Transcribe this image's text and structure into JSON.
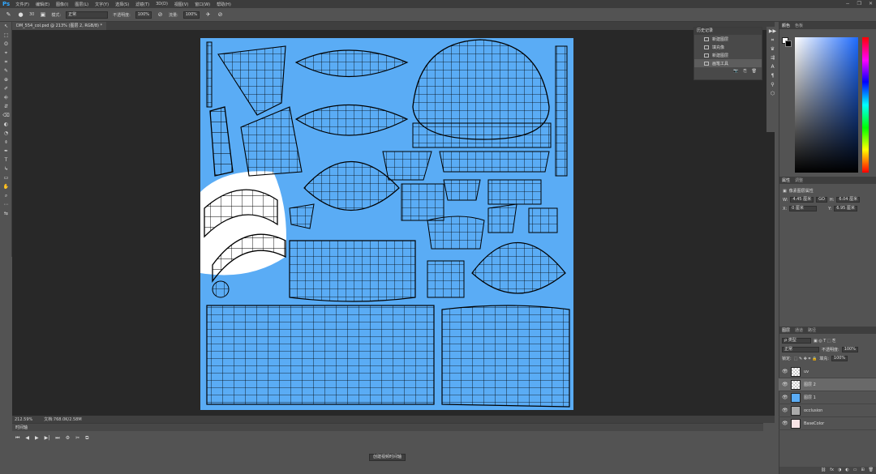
{
  "app": {
    "logo": "Ps"
  },
  "menu": [
    "文件(F)",
    "编辑(E)",
    "图像(I)",
    "图层(L)",
    "文字(Y)",
    "选择(S)",
    "滤镜(T)",
    "3D(D)",
    "视图(V)",
    "窗口(W)",
    "帮助(H)"
  ],
  "window_controls": [
    "−",
    "❐",
    "✕"
  ],
  "options": {
    "brush_size": "30",
    "mode_label": "模式:",
    "mode_value": "正常",
    "opacity_label": "不透明度:",
    "opacity_value": "100%",
    "flow_label": "流量:",
    "flow_value": "100%"
  },
  "tools": [
    "↖",
    "⬚",
    "ʘ",
    "⌖",
    "⌗",
    "✎",
    "⊕",
    "✐",
    "⎆",
    "⇵",
    "⌫",
    "◐",
    "◔",
    "⌽",
    "✒",
    "T",
    "↳",
    "▭",
    "✋",
    "⌕",
    "⋯",
    "⇆"
  ],
  "document_tab": "DM_554_col.psd @ 213% (图层 2, RGB/8) *",
  "status": {
    "zoom": "212.59%",
    "doc": "文档:768.0K/2.58M"
  },
  "timeline": {
    "title": "时间轴",
    "controls": [
      "⏮",
      "◀",
      "▶",
      "▶|",
      "⏭",
      "⚙",
      "✂",
      "⧉"
    ],
    "create_button": "创建视频时间轴"
  },
  "history": {
    "tabs": [
      "历史记录"
    ],
    "items": [
      {
        "label": "新建图层",
        "selected": false
      },
      {
        "label": "填充像",
        "selected": false
      },
      {
        "label": "新建图层",
        "selected": false
      },
      {
        "label": "画笔工具",
        "selected": true
      }
    ],
    "footer_icons": [
      "📷",
      "⎘",
      "🗑"
    ]
  },
  "icon_column": [
    "▶▶",
    "⌗",
    "♛",
    "⇶",
    "A",
    "¶",
    "⚲",
    "⬡"
  ],
  "color_panel": {
    "tabs": [
      "颜色",
      "色板"
    ],
    "fg": "#ffffff",
    "bg": "#000000"
  },
  "properties": {
    "tabs": [
      "属性",
      "调整"
    ],
    "title": "像素图层属性",
    "w_label": "W:",
    "w_value": "4.45 厘米",
    "link": "GO",
    "h_label": "H:",
    "h_value": "6.04 厘米",
    "x_label": "X:",
    "x_value": "0 厘米",
    "y_label": "Y:",
    "y_value": "6.95 厘米"
  },
  "layers": {
    "tabs": [
      "图层",
      "通道",
      "路径"
    ],
    "filter": "ρ 类型",
    "blend": "正常",
    "opacity_label": "不透明度:",
    "opacity": "100%",
    "lock_label": "锁定:",
    "fill_label": "填充:",
    "fill": "100%",
    "items": [
      {
        "name": "uv",
        "thumb": "check",
        "selected": false
      },
      {
        "name": "图层 2",
        "thumb": "check",
        "selected": true
      },
      {
        "name": "图层 1",
        "thumb": "blue",
        "selected": false
      },
      {
        "name": "occlusion",
        "thumb": "occ",
        "selected": false
      },
      {
        "name": "BaseColor",
        "thumb": "pink",
        "selected": false
      }
    ],
    "footer_icons": [
      "⛓",
      "fx",
      "◑",
      "◐",
      "▭",
      "⊞",
      "🗑"
    ]
  },
  "colors": {
    "canvas_fill": "#5aacf5",
    "accent": "#31a8ff",
    "wire": "#000000"
  }
}
